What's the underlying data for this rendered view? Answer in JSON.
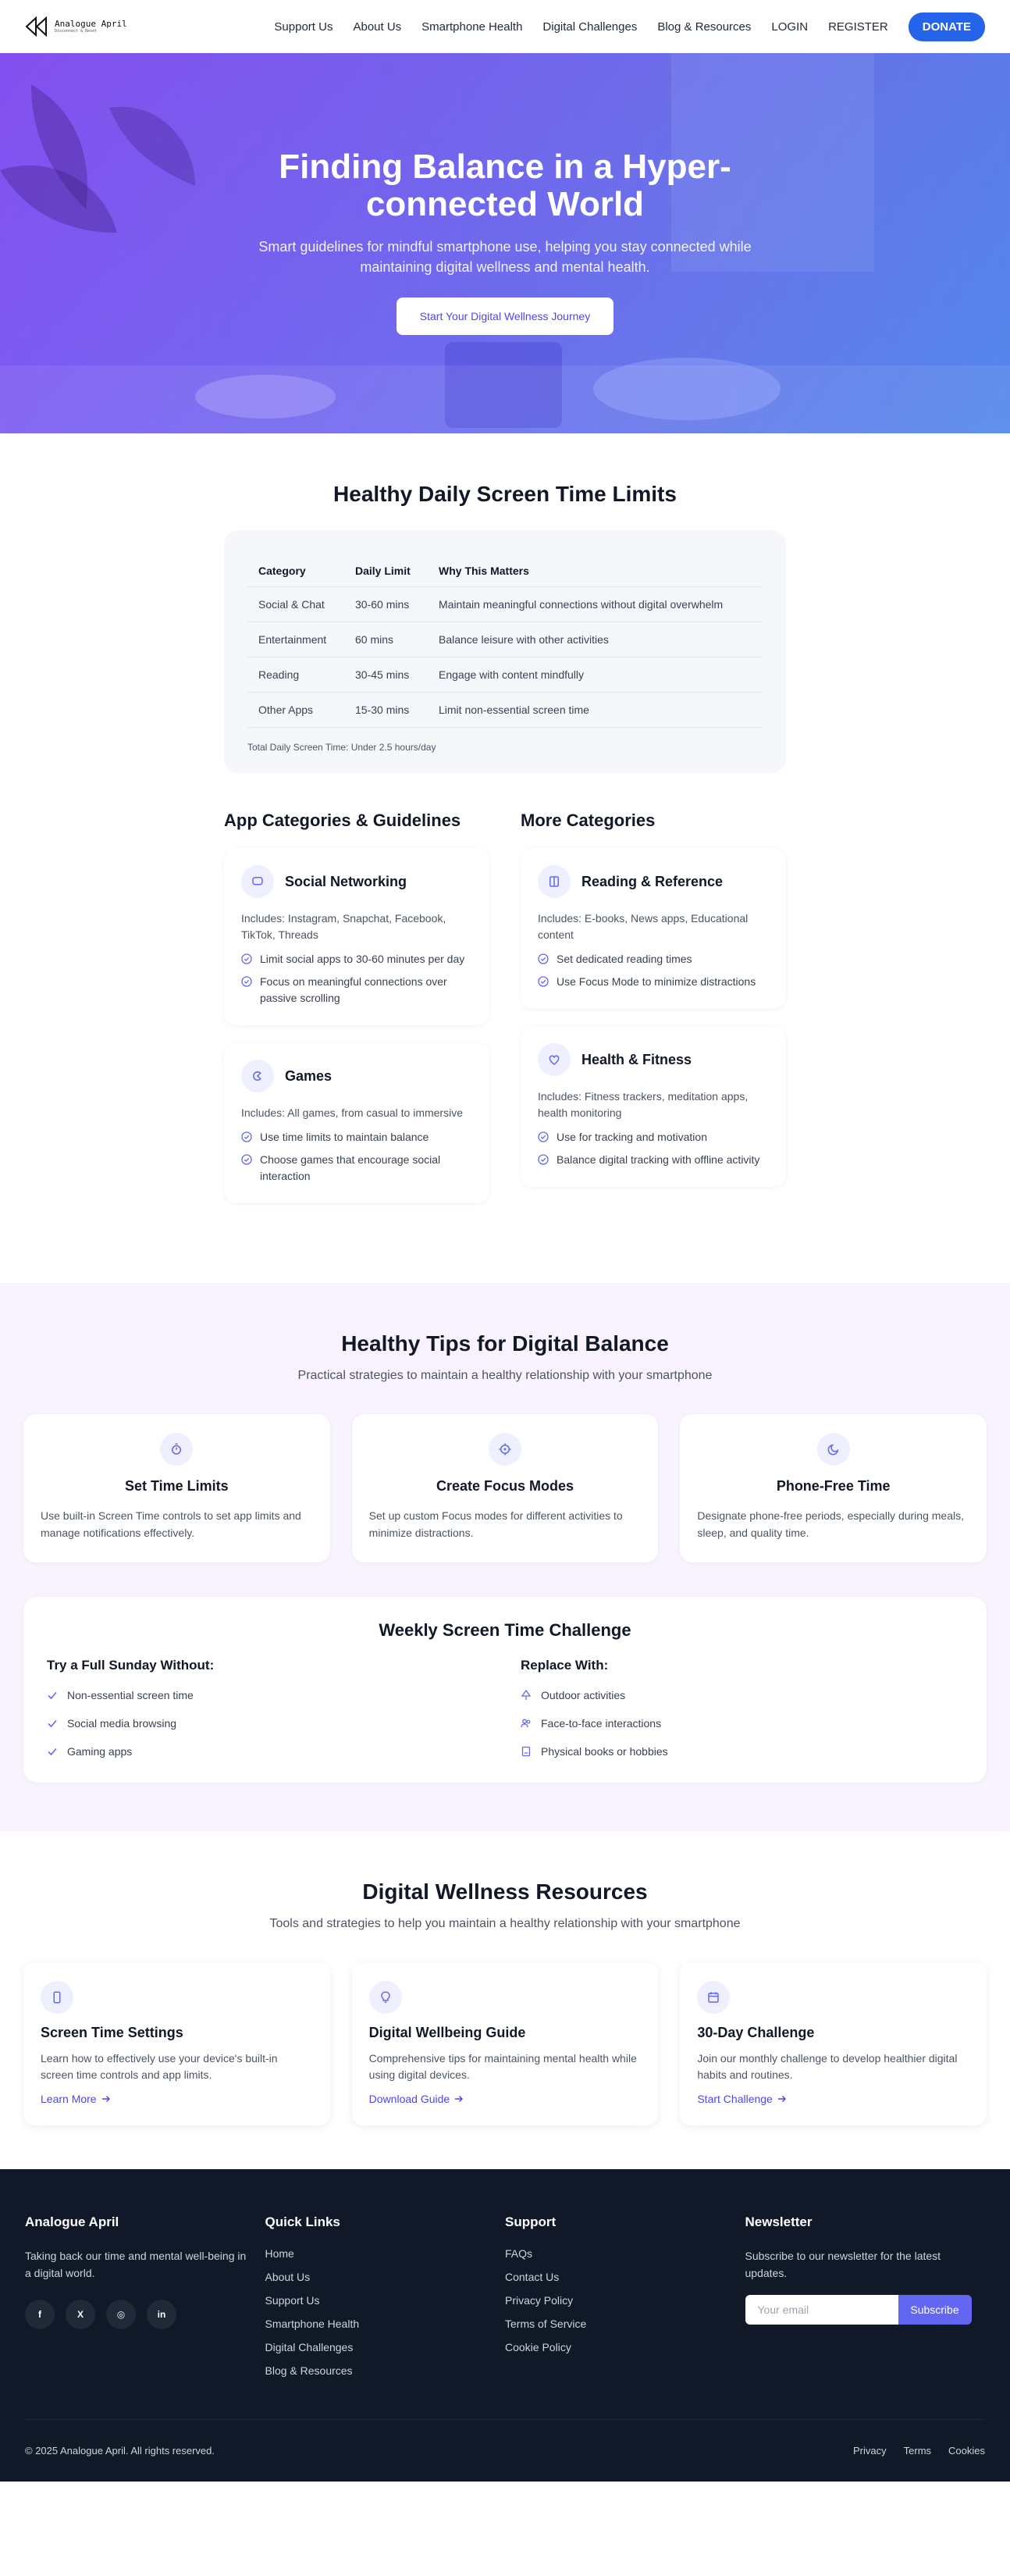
{
  "nav": {
    "logo_name": "Analogue April",
    "logo_tag": "Disconnect & Reset",
    "links": [
      "Support Us",
      "About Us",
      "Smartphone Health",
      "Digital Challenges",
      "Blog & Resources",
      "LOGIN",
      "REGISTER"
    ],
    "donate": "DONATE"
  },
  "hero": {
    "title": "Finding Balance in a Hyper-connected World",
    "subtitle": "Smart guidelines for mindful smartphone use, helping you stay connected while maintaining digital wellness and mental health.",
    "cta": "Start Your Digital Wellness Journey"
  },
  "limits": {
    "title": "Healthy Daily Screen Time Limits",
    "headers": [
      "Category",
      "Daily Limit",
      "Why This Matters"
    ],
    "rows": [
      [
        "Social & Chat",
        "30-60 mins",
        "Maintain meaningful connections without digital overwhelm"
      ],
      [
        "Entertainment",
        "60 mins",
        "Balance leisure with other activities"
      ],
      [
        "Reading",
        "30-45 mins",
        "Engage with content mindfully"
      ],
      [
        "Other Apps",
        "15-30 mins",
        "Limit non-essential screen time"
      ]
    ],
    "total": "Total Daily Screen Time: Under 2.5 hours/day"
  },
  "categories": {
    "left_title": "App Categories & Guidelines",
    "right_title": "More Categories",
    "left": [
      {
        "icon": "chat-icon",
        "name": "Social Networking",
        "includes": "Includes: Instagram, Snapchat, Facebook, TikTok, Threads",
        "items": [
          "Limit social apps to 30-60 minutes per day",
          "Focus on meaningful connections over passive scrolling"
        ]
      },
      {
        "icon": "gamepad-icon",
        "name": "Games",
        "includes": "Includes: All games, from casual to immersive",
        "items": [
          "Use time limits to maintain balance",
          "Choose games that encourage social interaction"
        ]
      }
    ],
    "right": [
      {
        "icon": "book-icon",
        "name": "Reading & Reference",
        "includes": "Includes: E-books, News apps, Educational content",
        "items": [
          "Set dedicated reading times",
          "Use Focus Mode to minimize distractions"
        ]
      },
      {
        "icon": "heart-pulse-icon",
        "name": "Health & Fitness",
        "includes": "Includes: Fitness trackers, meditation apps, health monitoring",
        "items": [
          "Use for tracking and motivation",
          "Balance digital tracking with offline activity"
        ]
      }
    ]
  },
  "tips": {
    "title": "Healthy Tips for Digital Balance",
    "subtitle": "Practical strategies to maintain a healthy relationship with your smartphone",
    "cards": [
      {
        "icon": "timer-icon",
        "title": "Set Time Limits",
        "text": "Use built-in Screen Time controls to set app limits and manage notifications effectively."
      },
      {
        "icon": "target-icon",
        "title": "Create Focus Modes",
        "text": "Set up custom Focus modes for different activities to minimize distractions."
      },
      {
        "icon": "moon-icon",
        "title": "Phone-Free Time",
        "text": "Designate phone-free periods, especially during meals, sleep, and quality time."
      }
    ]
  },
  "challenge": {
    "title": "Weekly Screen Time Challenge",
    "left_title": "Try a Full Sunday Without:",
    "left_items": [
      "Non-essential screen time",
      "Social media browsing",
      "Gaming apps"
    ],
    "right_title": "Replace With:",
    "right_items": [
      {
        "icon": "tree-icon",
        "label": "Outdoor activities"
      },
      {
        "icon": "users-icon",
        "label": "Face-to-face interactions"
      },
      {
        "icon": "book-icon",
        "label": "Physical books or hobbies"
      }
    ]
  },
  "resources": {
    "title": "Digital Wellness Resources",
    "subtitle": "Tools and strategies to help you maintain a healthy relationship with your smartphone",
    "cards": [
      {
        "icon": "phone-icon",
        "title": "Screen Time Settings",
        "text": "Learn how to effectively use your device's built-in screen time controls and app limits.",
        "link": "Learn More"
      },
      {
        "icon": "lightbulb-icon",
        "title": "Digital Wellbeing Guide",
        "text": "Comprehensive tips for maintaining mental health while using digital devices.",
        "link": "Download Guide"
      },
      {
        "icon": "calendar-icon",
        "title": "30-Day Challenge",
        "text": "Join our monthly challenge to develop healthier digital habits and routines.",
        "link": "Start Challenge"
      }
    ]
  },
  "footer": {
    "brand": "Analogue April",
    "about": "Taking back our time and mental well-being in a digital world.",
    "socials": [
      "f",
      "X",
      "◎",
      "in"
    ],
    "quick_title": "Quick Links",
    "quick_links": [
      "Home",
      "About Us",
      "Support Us",
      "Smartphone Health",
      "Digital Challenges",
      "Blog & Resources"
    ],
    "support_title": "Support",
    "support_links": [
      "FAQs",
      "Contact Us",
      "Privacy Policy",
      "Terms of Service",
      "Cookie Policy"
    ],
    "newsletter_title": "Newsletter",
    "newsletter_text": "Subscribe to our newsletter for the latest updates.",
    "email_placeholder": "Your email",
    "subscribe": "Subscribe",
    "copyright": "© 2025 Analogue April. All rights reserved.",
    "legal": [
      "Privacy",
      "Terms",
      "Cookies"
    ]
  },
  "colors": {
    "accent": "#4f46e5",
    "donate": "#2563eb",
    "footer_bg": "#111827",
    "tips_bg": "#f8f3ff"
  }
}
